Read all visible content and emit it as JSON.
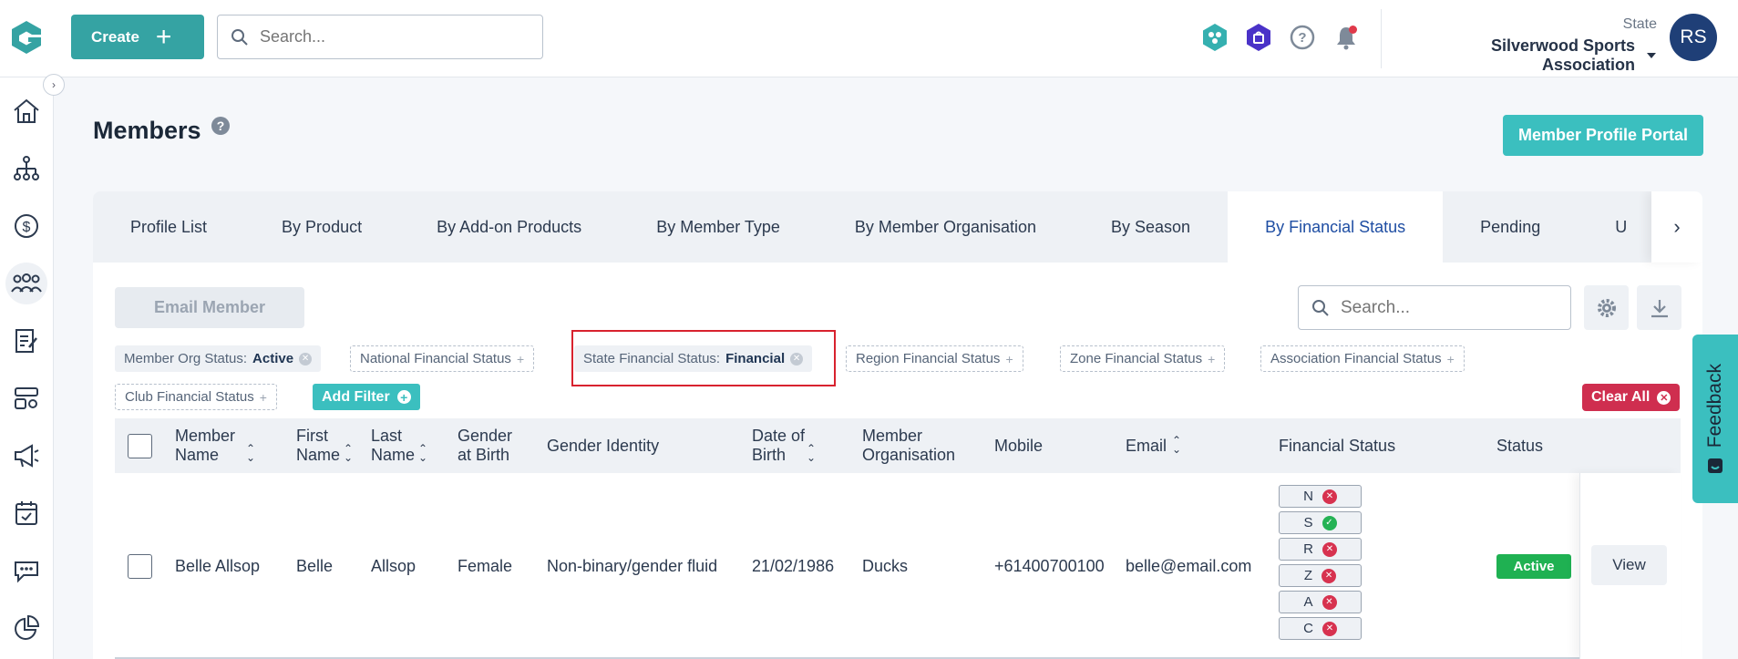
{
  "header": {
    "create_label": "Create",
    "search_placeholder": "Search...",
    "org_level": "State",
    "org_name": "Silverwood Sports Association",
    "avatar_initials": "RS",
    "accent": "#35a3a3"
  },
  "page": {
    "title": "Members",
    "portal_button": "Member Profile Portal"
  },
  "tabs": [
    "Profile List",
    "By Product",
    "By Add-on Products",
    "By Member Type",
    "By Member Organisation",
    "By Season",
    "By Financial Status",
    "Pending",
    "U"
  ],
  "toolbar": {
    "email_member": "Email Member",
    "search_placeholder": "Search..."
  },
  "filters": {
    "member_org_status_label": "Member Org Status:",
    "member_org_status_value": "Active",
    "national": "National Financial Status",
    "state_label": "State Financial Status:",
    "state_value": "Financial",
    "region": "Region Financial Status",
    "zone": "Zone Financial Status",
    "association": "Association Financial Status",
    "club": "Club Financial Status",
    "add_filter": "Add Filter",
    "clear_all": "Clear All"
  },
  "table": {
    "columns": {
      "member_name": "Member Name",
      "first_name": "First Name",
      "last_name": "Last Name",
      "gender_birth": "Gender at Birth",
      "gender_identity": "Gender Identity",
      "dob": "Date of Birth",
      "member_org": "Member Organisation",
      "mobile": "Mobile",
      "email": "Email",
      "financial_status": "Financial Status",
      "status": "Status"
    },
    "rows": [
      {
        "member_name": "Belle Allsop",
        "first_name": "Belle",
        "last_name": "Allsop",
        "gender_birth": "Female",
        "gender_identity": "Non-binary/gender fluid",
        "dob": "21/02/1986",
        "member_org": "Ducks",
        "mobile": "+61400700100",
        "email": "belle@email.com",
        "financial": [
          {
            "level": "N",
            "ok": false
          },
          {
            "level": "S",
            "ok": true
          },
          {
            "level": "R",
            "ok": false
          },
          {
            "level": "Z",
            "ok": false
          },
          {
            "level": "A",
            "ok": false
          },
          {
            "level": "C",
            "ok": false
          }
        ],
        "status": "Active",
        "action": "View"
      }
    ]
  },
  "feedback_label": "Feedback"
}
